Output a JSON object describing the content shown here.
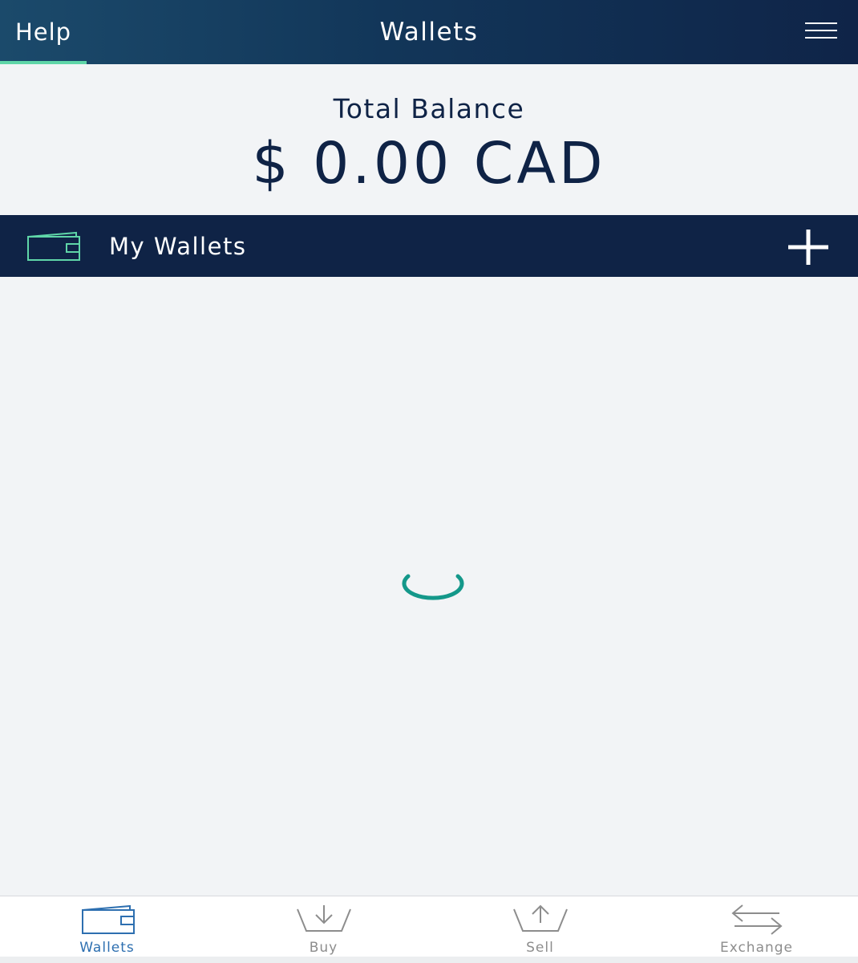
{
  "header": {
    "help_label": "Help",
    "title": "Wallets",
    "menu_icon": "hamburger-menu-icon"
  },
  "balance": {
    "label": "Total Balance",
    "value": "$ 0.00 CAD"
  },
  "wallets_section": {
    "title": "My Wallets",
    "wallet_icon": "wallet-icon",
    "add_icon": "plus-icon"
  },
  "status": {
    "loading": true,
    "spinner_icon": "loading-spinner-icon"
  },
  "tabbar": {
    "tabs": [
      {
        "label": "Wallets",
        "icon": "wallet-icon",
        "active": true
      },
      {
        "label": "Buy",
        "icon": "basket-download-icon",
        "active": false
      },
      {
        "label": "Sell",
        "icon": "basket-upload-icon",
        "active": false
      },
      {
        "label": "Exchange",
        "icon": "exchange-arrows-icon",
        "active": false
      }
    ]
  },
  "colors": {
    "navy": "#0f2346",
    "accent_green": "#5fd6a8",
    "spinner_teal": "#14988a",
    "active_tab_blue": "#2d6fb0",
    "inactive_tab_gray": "#8d8d8d"
  }
}
